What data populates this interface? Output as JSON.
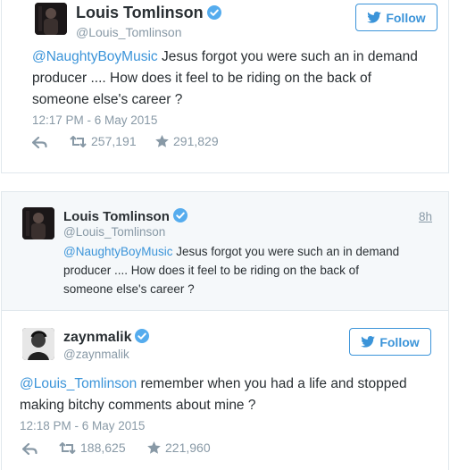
{
  "tweet1": {
    "name": "Louis Tomlinson",
    "handle": "@Louis_Tomlinson",
    "follow_label": "Follow",
    "mention": "@NaughtyBoyMusic",
    "line1_rest": " Jesus forgot you were such an in demand",
    "line2": "producer .... How does it feel to be riding on the back of",
    "line3": "someone else's career ?",
    "timestamp": "12:17 PM - 6 May 2015",
    "retweets": "257,191",
    "favorites": "291,829"
  },
  "quoted": {
    "name": "Louis Tomlinson",
    "handle": "@Louis_Tomlinson",
    "age": "8h",
    "mention": "@NaughtyBoyMusic",
    "line1_rest": " Jesus forgot you were such an in demand",
    "line2": "producer .... How does it feel to be riding on the back of",
    "line3": "someone else's career ?"
  },
  "tweet2": {
    "name": "zaynmalik",
    "handle": "@zaynmalik",
    "follow_label": "Follow",
    "mention": "@Louis_Tomlinson",
    "line1_rest": " remember when you had a life and stopped",
    "line2": "making bitchy comments about mine ?",
    "timestamp": "12:18 PM - 6 May 2015",
    "retweets": "188,625",
    "favorites": "221,960"
  },
  "icons": {
    "verified": "verified-badge-icon",
    "bird": "twitter-bird-icon",
    "reply": "reply-icon",
    "retweet": "retweet-icon",
    "favorite": "star-icon"
  },
  "colors": {
    "link": "#3b94d9",
    "verified": "#55acee",
    "meta": "#8899a6",
    "text": "#292f33"
  }
}
